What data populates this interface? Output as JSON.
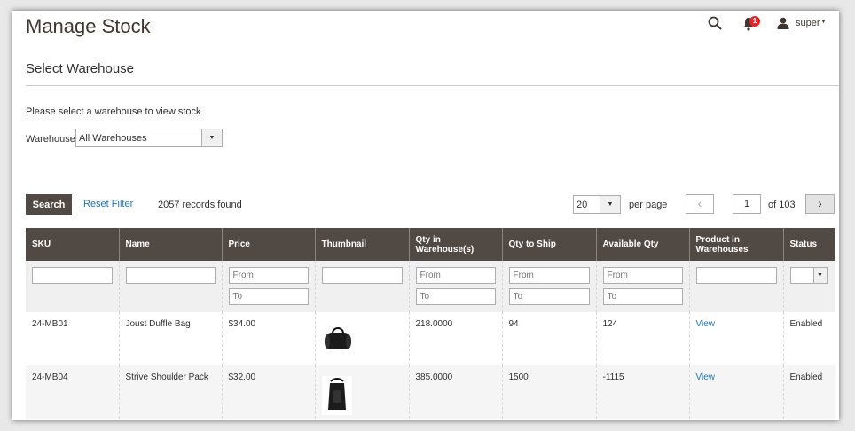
{
  "header": {
    "title": "Manage Stock",
    "notifications_count": "1",
    "user_name": "super"
  },
  "warehouse_section": {
    "title": "Select Warehouse",
    "help": "Please select a warehouse to view stock",
    "label": "Warehouse",
    "selected": "All Warehouses"
  },
  "toolbar": {
    "search_label": "Search",
    "reset_label": "Reset Filter",
    "records": "2057 records found",
    "per_page_value": "20",
    "per_page_label": "per page",
    "current_page": "1",
    "of_pages": "of 103"
  },
  "grid": {
    "columns": [
      "SKU",
      "Name",
      "Price",
      "Thumbnail",
      "Qty in Warehouse(s)",
      "Qty to Ship",
      "Available Qty",
      "Product in Warehouses",
      "Status"
    ],
    "filters": {
      "from": "From",
      "to": "To"
    },
    "rows": [
      {
        "sku": "24-MB01",
        "name": "Joust Duffle Bag",
        "price": "$34.00",
        "qty_wh": "218.0000",
        "qty_ship": "94",
        "available": "124",
        "link": "View",
        "status": "Enabled"
      },
      {
        "sku": "24-MB04",
        "name": "Strive Shoulder Pack",
        "price": "$32.00",
        "qty_wh": "385.0000",
        "qty_ship": "1500",
        "available": "-1115",
        "link": "View",
        "status": "Enabled"
      }
    ]
  },
  "colors": {
    "header_bg": "#514943",
    "link": "#1979c3",
    "badge": "#e22626"
  }
}
